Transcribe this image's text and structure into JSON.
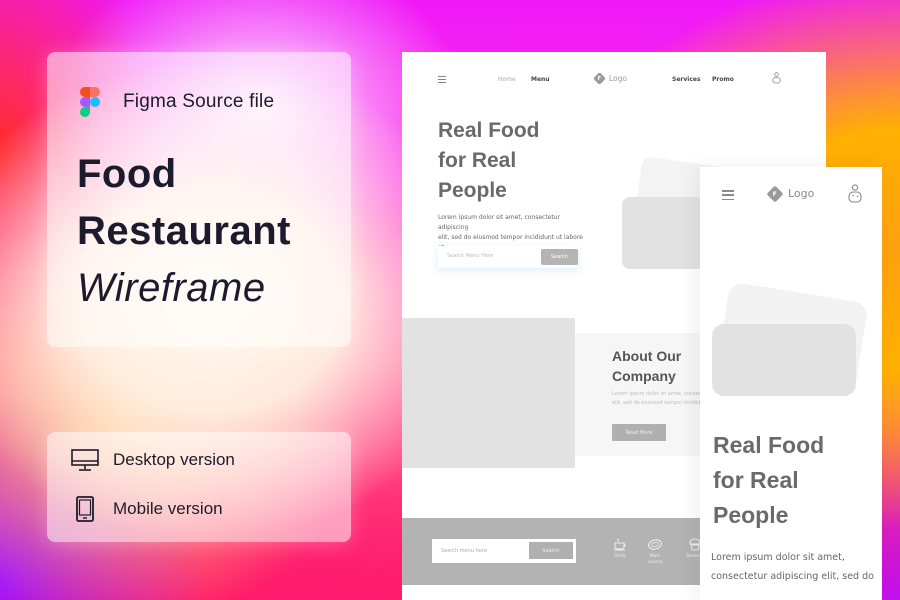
{
  "promo": {
    "source_label": "Figma Source file",
    "title_line1": "Food",
    "title_line2": "Restaurant",
    "title_line3": "Wireframe",
    "versions": [
      {
        "icon": "desktop-monitor-icon",
        "label": "Desktop version"
      },
      {
        "icon": "mobile-phone-icon",
        "label": "Mobile version"
      }
    ]
  },
  "desktop": {
    "nav": {
      "menu_icon": "hamburger-icon",
      "links_left": [
        "Home",
        "Menu"
      ],
      "logo_letter": "F",
      "logo_text": "Logo",
      "links_right": [
        "Services",
        "Promo"
      ],
      "user_icon": "user-icon"
    },
    "hero": {
      "title_line1": "Real Food",
      "title_line2": "for Real",
      "title_line3": "People",
      "text_line1": "Lorem ipsum dolor sit amet, consectetur adipiscing",
      "text_line2": "elit, sed do eiusmod tempor incididunt ut labore et",
      "search_placeholder": "Search Menu Here",
      "search_button": "Search"
    },
    "about": {
      "title_line1": "About Our",
      "title_line2": "Company",
      "text_line1": "Lorem ipsum dolor sit amet, consectetur",
      "text_line2": "elit, sed do eiusmod tempor incididunt",
      "button": "Read More"
    },
    "footer": {
      "search_placeholder": "Search menu here",
      "search_button": "Search",
      "categories": [
        {
          "icon": "drink-cup-icon",
          "label_line1": "Drink",
          "label_line2": ""
        },
        {
          "icon": "main-course-plate-icon",
          "label_line1": "Main",
          "label_line2": "course"
        },
        {
          "icon": "dessert-cupcake-icon",
          "label_line1": "Dessert",
          "label_line2": ""
        }
      ]
    }
  },
  "mobile": {
    "nav": {
      "menu_icon": "hamburger-icon",
      "logo_letter": "F",
      "logo_text": "Logo",
      "user_icon": "user-icon"
    },
    "hero": {
      "title_line1": "Real Food",
      "title_line2": "for Real",
      "title_line3": "People",
      "text_line1": "Lorem ipsum dolor sit amet,",
      "text_line2": "consectetur adipiscing elit, sed do"
    }
  }
}
